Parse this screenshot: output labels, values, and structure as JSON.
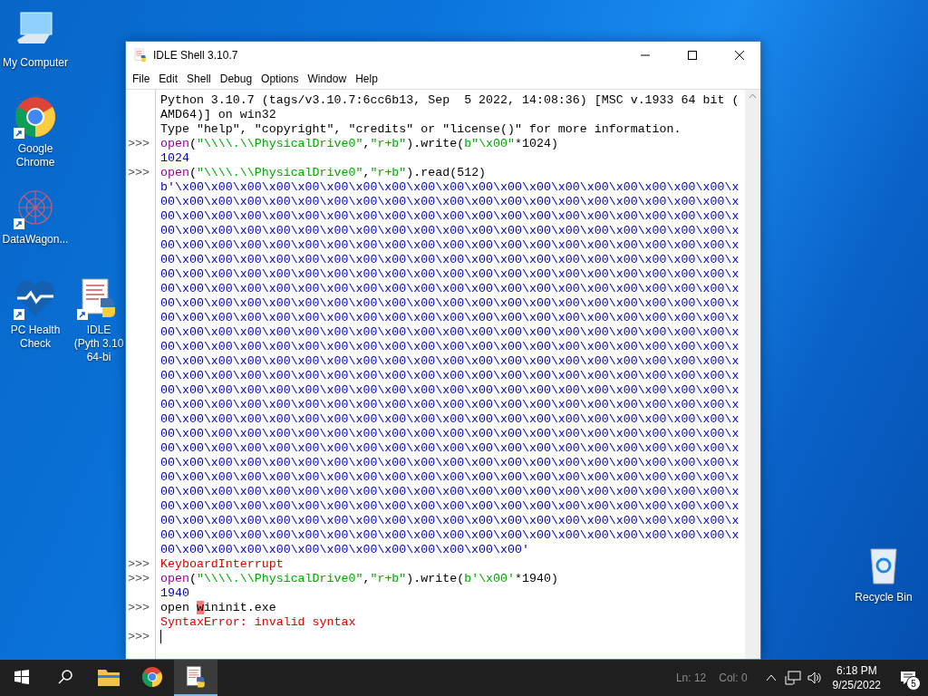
{
  "desktop_icons": [
    {
      "kind": "computer",
      "label": "My Computer",
      "shortcut": false
    },
    {
      "kind": "chrome",
      "label": "Google Chrome",
      "shortcut": true
    },
    {
      "kind": "ornament",
      "label": "DataWagon...",
      "shortcut": true
    },
    {
      "kind": "health",
      "label": "PC Health Check",
      "shortcut": true
    },
    {
      "kind": "idle",
      "label": "IDLE (Pyth 3.10 64-bi",
      "shortcut": true
    },
    {
      "kind": "bin",
      "label": "Recycle Bin",
      "shortcut": false
    }
  ],
  "window": {
    "title": "IDLE Shell 3.10.7",
    "menu": [
      "File",
      "Edit",
      "Shell",
      "Debug",
      "Options",
      "Window",
      "Help"
    ],
    "lines": [
      {
        "segments": [
          {
            "kind": "plain",
            "text": "Python 3.10.7 (tags/v3.10.7:6cc6b13, Sep  5 2022, 14:08:36) [MSC v.1933 64 bit ("
          }
        ]
      },
      {
        "segments": [
          {
            "kind": "plain",
            "text": "AMD64)] on win32"
          }
        ]
      },
      {
        "segments": [
          {
            "kind": "plain",
            "text": "Type \"help\", \"copyright\", \"credits\" or \"license()\" for more information."
          }
        ]
      },
      {
        "prompt": ">>>",
        "segments": [
          {
            "kind": "builtin",
            "text": "open"
          },
          {
            "kind": "plain",
            "text": "("
          },
          {
            "kind": "string",
            "text": "\"\\\\\\\\.\\\\PhysicalDrive0\""
          },
          {
            "kind": "plain",
            "text": ","
          },
          {
            "kind": "string",
            "text": "\"r+b\""
          },
          {
            "kind": "plain",
            "text": ").write("
          },
          {
            "kind": "string",
            "text": "b\"\\x00\""
          },
          {
            "kind": "plain",
            "text": "*1024)"
          }
        ]
      },
      {
        "segments": [
          {
            "kind": "output",
            "text": "1024"
          }
        ]
      },
      {
        "prompt": ">>>",
        "segments": [
          {
            "kind": "builtin",
            "text": "open"
          },
          {
            "kind": "plain",
            "text": "("
          },
          {
            "kind": "string",
            "text": "\"\\\\\\\\.\\\\PhysicalDrive0\""
          },
          {
            "kind": "plain",
            "text": ","
          },
          {
            "kind": "string",
            "text": "\"r+b\""
          },
          {
            "kind": "plain",
            "text": ").read(512)"
          }
        ]
      },
      {
        "segments": [
          {
            "kind": "output",
            "text": "b'\\x00\\x00\\x00\\x00\\x00\\x00\\x00\\x00\\x00\\x00\\x00\\x00\\x00\\x00\\x00\\x00\\x00\\x00\\x00\\x"
          }
        ]
      },
      {
        "segments": [
          {
            "kind": "output",
            "text": "00\\x00\\x00\\x00\\x00\\x00\\x00\\x00\\x00\\x00\\x00\\x00\\x00\\x00\\x00\\x00\\x00\\x00\\x00\\x00\\x"
          }
        ]
      },
      {
        "segments": [
          {
            "kind": "output",
            "text": "00\\x00\\x00\\x00\\x00\\x00\\x00\\x00\\x00\\x00\\x00\\x00\\x00\\x00\\x00\\x00\\x00\\x00\\x00\\x00\\x"
          }
        ]
      },
      {
        "segments": [
          {
            "kind": "output",
            "text": "00\\x00\\x00\\x00\\x00\\x00\\x00\\x00\\x00\\x00\\x00\\x00\\x00\\x00\\x00\\x00\\x00\\x00\\x00\\x00\\x"
          }
        ]
      },
      {
        "segments": [
          {
            "kind": "output",
            "text": "00\\x00\\x00\\x00\\x00\\x00\\x00\\x00\\x00\\x00\\x00\\x00\\x00\\x00\\x00\\x00\\x00\\x00\\x00\\x00\\x"
          }
        ]
      },
      {
        "segments": [
          {
            "kind": "output",
            "text": "00\\x00\\x00\\x00\\x00\\x00\\x00\\x00\\x00\\x00\\x00\\x00\\x00\\x00\\x00\\x00\\x00\\x00\\x00\\x00\\x"
          }
        ]
      },
      {
        "segments": [
          {
            "kind": "output",
            "text": "00\\x00\\x00\\x00\\x00\\x00\\x00\\x00\\x00\\x00\\x00\\x00\\x00\\x00\\x00\\x00\\x00\\x00\\x00\\x00\\x"
          }
        ]
      },
      {
        "segments": [
          {
            "kind": "output",
            "text": "00\\x00\\x00\\x00\\x00\\x00\\x00\\x00\\x00\\x00\\x00\\x00\\x00\\x00\\x00\\x00\\x00\\x00\\x00\\x00\\x"
          }
        ]
      },
      {
        "segments": [
          {
            "kind": "output",
            "text": "00\\x00\\x00\\x00\\x00\\x00\\x00\\x00\\x00\\x00\\x00\\x00\\x00\\x00\\x00\\x00\\x00\\x00\\x00\\x00\\x"
          }
        ]
      },
      {
        "segments": [
          {
            "kind": "output",
            "text": "00\\x00\\x00\\x00\\x00\\x00\\x00\\x00\\x00\\x00\\x00\\x00\\x00\\x00\\x00\\x00\\x00\\x00\\x00\\x00\\x"
          }
        ]
      },
      {
        "segments": [
          {
            "kind": "output",
            "text": "00\\x00\\x00\\x00\\x00\\x00\\x00\\x00\\x00\\x00\\x00\\x00\\x00\\x00\\x00\\x00\\x00\\x00\\x00\\x00\\x"
          }
        ]
      },
      {
        "segments": [
          {
            "kind": "output",
            "text": "00\\x00\\x00\\x00\\x00\\x00\\x00\\x00\\x00\\x00\\x00\\x00\\x00\\x00\\x00\\x00\\x00\\x00\\x00\\x00\\x"
          }
        ]
      },
      {
        "segments": [
          {
            "kind": "output",
            "text": "00\\x00\\x00\\x00\\x00\\x00\\x00\\x00\\x00\\x00\\x00\\x00\\x00\\x00\\x00\\x00\\x00\\x00\\x00\\x00\\x"
          }
        ]
      },
      {
        "segments": [
          {
            "kind": "output",
            "text": "00\\x00\\x00\\x00\\x00\\x00\\x00\\x00\\x00\\x00\\x00\\x00\\x00\\x00\\x00\\x00\\x00\\x00\\x00\\x00\\x"
          }
        ]
      },
      {
        "segments": [
          {
            "kind": "output",
            "text": "00\\x00\\x00\\x00\\x00\\x00\\x00\\x00\\x00\\x00\\x00\\x00\\x00\\x00\\x00\\x00\\x00\\x00\\x00\\x00\\x"
          }
        ]
      },
      {
        "segments": [
          {
            "kind": "output",
            "text": "00\\x00\\x00\\x00\\x00\\x00\\x00\\x00\\x00\\x00\\x00\\x00\\x00\\x00\\x00\\x00\\x00\\x00\\x00\\x00\\x"
          }
        ]
      },
      {
        "segments": [
          {
            "kind": "output",
            "text": "00\\x00\\x00\\x00\\x00\\x00\\x00\\x00\\x00\\x00\\x00\\x00\\x00\\x00\\x00\\x00\\x00\\x00\\x00\\x00\\x"
          }
        ]
      },
      {
        "segments": [
          {
            "kind": "output",
            "text": "00\\x00\\x00\\x00\\x00\\x00\\x00\\x00\\x00\\x00\\x00\\x00\\x00\\x00\\x00\\x00\\x00\\x00\\x00\\x00\\x"
          }
        ]
      },
      {
        "segments": [
          {
            "kind": "output",
            "text": "00\\x00\\x00\\x00\\x00\\x00\\x00\\x00\\x00\\x00\\x00\\x00\\x00\\x00\\x00\\x00\\x00\\x00\\x00\\x00\\x"
          }
        ]
      },
      {
        "segments": [
          {
            "kind": "output",
            "text": "00\\x00\\x00\\x00\\x00\\x00\\x00\\x00\\x00\\x00\\x00\\x00\\x00\\x00\\x00\\x00\\x00\\x00\\x00\\x00\\x"
          }
        ]
      },
      {
        "segments": [
          {
            "kind": "output",
            "text": "00\\x00\\x00\\x00\\x00\\x00\\x00\\x00\\x00\\x00\\x00\\x00\\x00\\x00\\x00\\x00\\x00\\x00\\x00\\x00\\x"
          }
        ]
      },
      {
        "segments": [
          {
            "kind": "output",
            "text": "00\\x00\\x00\\x00\\x00\\x00\\x00\\x00\\x00\\x00\\x00\\x00\\x00\\x00\\x00\\x00\\x00\\x00\\x00\\x00\\x"
          }
        ]
      },
      {
        "segments": [
          {
            "kind": "output",
            "text": "00\\x00\\x00\\x00\\x00\\x00\\x00\\x00\\x00\\x00\\x00\\x00\\x00\\x00\\x00\\x00\\x00\\x00\\x00\\x00\\x"
          }
        ]
      },
      {
        "segments": [
          {
            "kind": "output",
            "text": "00\\x00\\x00\\x00\\x00\\x00\\x00\\x00\\x00\\x00\\x00\\x00\\x00\\x00\\x00\\x00\\x00\\x00\\x00\\x00\\x"
          }
        ]
      },
      {
        "segments": [
          {
            "kind": "output",
            "text": "00\\x00\\x00\\x00\\x00\\x00\\x00\\x00\\x00\\x00\\x00\\x00\\x00\\x00\\x00\\x00\\x00\\x00\\x00\\x00\\x"
          }
        ]
      },
      {
        "segments": [
          {
            "kind": "output",
            "text": "00\\x00\\x00\\x00\\x00\\x00\\x00\\x00\\x00\\x00\\x00\\x00\\x00'"
          }
        ]
      },
      {
        "prompt": ">>>",
        "segments": [
          {
            "kind": "error",
            "text": "KeyboardInterrupt"
          }
        ]
      },
      {
        "prompt": ">>>",
        "segments": [
          {
            "kind": "builtin",
            "text": "open"
          },
          {
            "kind": "plain",
            "text": "("
          },
          {
            "kind": "string",
            "text": "\"\\\\\\\\.\\\\PhysicalDrive0\""
          },
          {
            "kind": "plain",
            "text": ","
          },
          {
            "kind": "string",
            "text": "\"r+b\""
          },
          {
            "kind": "plain",
            "text": ").write("
          },
          {
            "kind": "string",
            "text": "b'\\x00'"
          },
          {
            "kind": "plain",
            "text": "*1940)"
          }
        ]
      },
      {
        "segments": [
          {
            "kind": "output",
            "text": "1940"
          }
        ]
      },
      {
        "prompt": ">>>",
        "segments": [
          {
            "kind": "plain",
            "text": "open "
          },
          {
            "kind": "mark",
            "text": "w"
          },
          {
            "kind": "plain",
            "text": "ininit.exe"
          }
        ]
      },
      {
        "segments": [
          {
            "kind": "error",
            "text": "SyntaxError: invalid syntax"
          }
        ]
      },
      {
        "prompt": ">>>",
        "cursor": true
      }
    ],
    "status": [
      "Ln: 12",
      "Col: 0"
    ]
  },
  "taskbar": {
    "apps": [
      {
        "kind": "folder",
        "selected": false
      },
      {
        "kind": "chrome",
        "selected": false
      },
      {
        "kind": "idle",
        "selected": true
      }
    ],
    "time": "6:18 PM",
    "date": "9/25/2022",
    "notifications": "5"
  }
}
